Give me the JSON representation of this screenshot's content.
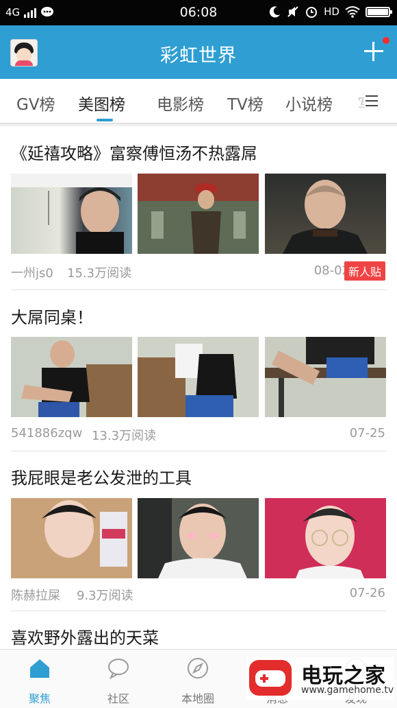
{
  "status_bar": {
    "network": "4G",
    "time": "06:08",
    "hd": "HD"
  },
  "app_bar": {
    "title": "彩虹世界"
  },
  "tabs": [
    {
      "label": "GV榜"
    },
    {
      "label": "美图榜"
    },
    {
      "label": "电影榜"
    },
    {
      "label": "TV榜"
    },
    {
      "label": "小说榜"
    },
    {
      "label": "写"
    }
  ],
  "active_tab": "美图榜",
  "posts": [
    {
      "title": "《延禧攻略》富察傅恒汤不热露屌",
      "author": "一州js0",
      "reads": "15.3万阅读",
      "date": "08-02",
      "badge": "新人贴"
    },
    {
      "title": "大屌同桌！",
      "author": "541886zqw",
      "reads": "13.3万阅读",
      "date": "07-25"
    },
    {
      "title": "我屁眼是老公发泄的工具",
      "author": "陈赫拉屎",
      "reads": "9.3万阅读",
      "date": "07-26"
    },
    {
      "title": "喜欢野外露出的天菜"
    }
  ],
  "bottom_nav": [
    {
      "label": "聚焦"
    },
    {
      "label": "社区"
    },
    {
      "label": "本地圈"
    },
    {
      "label": "消息"
    },
    {
      "label": "发现"
    }
  ],
  "watermark": {
    "title": "电玩之家",
    "url": "www.gamehome.tv"
  },
  "colors": {
    "accent": "#2f9ed3",
    "badge": "#f04343"
  }
}
